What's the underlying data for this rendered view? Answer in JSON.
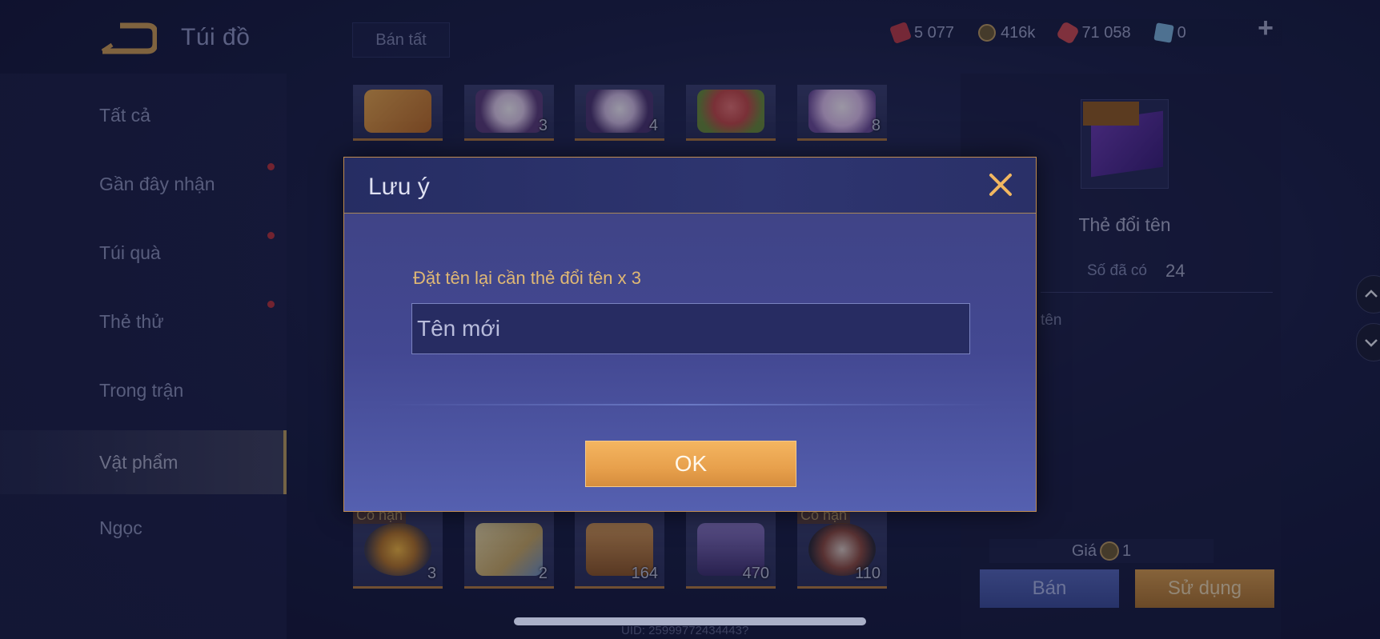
{
  "header": {
    "title": "Túi đồ",
    "sell_all": "Bán tất",
    "currencies": [
      {
        "icon": "red-voucher-icon",
        "value": "5 077",
        "color": "#b83a48"
      },
      {
        "icon": "gold-coin-icon",
        "value": "416k",
        "color": "#b99860"
      },
      {
        "icon": "ruby-icon",
        "value": "71 058",
        "color": "#c84a52"
      },
      {
        "icon": "blue-card-icon",
        "value": "0",
        "color": "#7ab0d8"
      }
    ]
  },
  "sidebar": {
    "items": [
      {
        "label": "Tất cả",
        "dot": false
      },
      {
        "label": "Gần đây nhận",
        "dot": true
      },
      {
        "label": "Túi quà",
        "dot": true
      },
      {
        "label": "Thẻ thử",
        "dot": true
      },
      {
        "label": "Trong trận",
        "dot": false
      },
      {
        "label": "Vật phẩm",
        "dot": false,
        "active": true
      },
      {
        "label": "Ngọc",
        "dot": false
      }
    ]
  },
  "grid": {
    "top_row": [
      {
        "icon": "ticket-card-icon",
        "qty": ""
      },
      {
        "icon": "kuromi-icon",
        "qty": "3"
      },
      {
        "icon": "kuromi-dance-icon",
        "qty": "4"
      },
      {
        "icon": "flower-bouquet-icon",
        "qty": ""
      },
      {
        "icon": "moon-icon",
        "qty": "8"
      }
    ],
    "bottom_row": [
      {
        "icon": "sun-emblem-icon",
        "qty": "3",
        "limited": "Có hạn"
      },
      {
        "icon": "scroll-map-icon",
        "qty": "2",
        "limited": ""
      },
      {
        "icon": "armor-chest-icon",
        "qty": "164",
        "limited": ""
      },
      {
        "icon": "helmet-icon",
        "qty": "470",
        "limited": ""
      },
      {
        "icon": "crossed-swords-icon",
        "qty": "110",
        "limited": "Có hạn"
      }
    ]
  },
  "detail": {
    "name": "Thẻ đổi tên",
    "owned_label": "Số đã có",
    "owned_value": "24",
    "desc_fragment": "tên",
    "price_label": "Giá",
    "price_value": "1",
    "sell_label": "Bán",
    "use_label": "Sử dụng"
  },
  "uid": "UID: 25999772434443?",
  "modal": {
    "title": "Lưu ý",
    "prompt": "Đặt tên lại cần thẻ đổi tên x 3",
    "input_placeholder": "Tên mới",
    "input_value": "",
    "ok_label": "OK"
  }
}
